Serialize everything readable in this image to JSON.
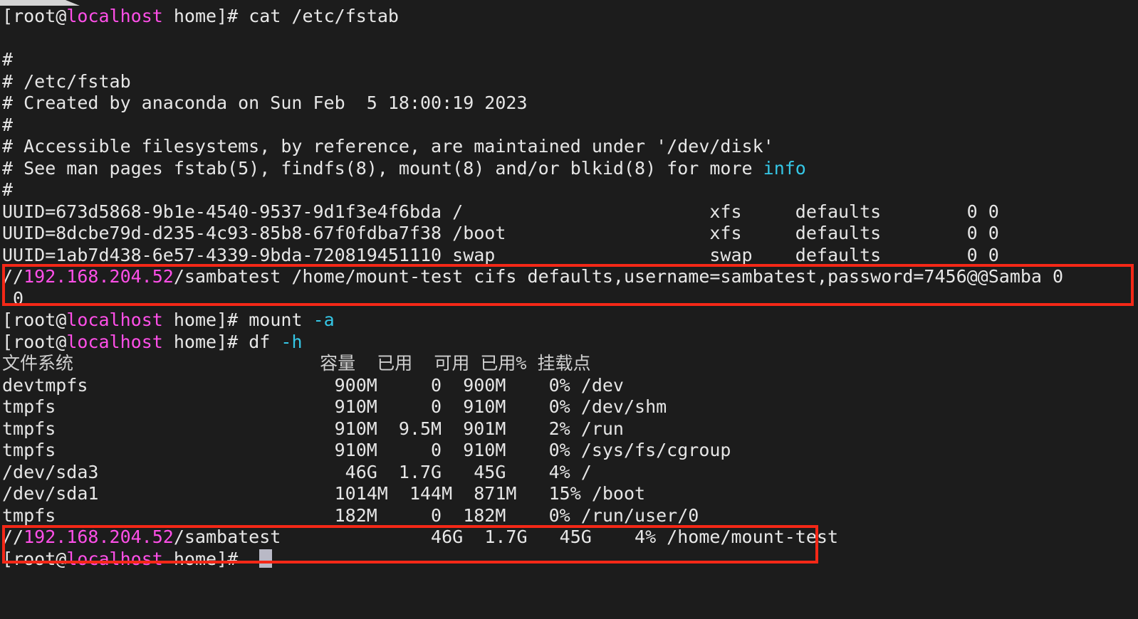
{
  "terminal": {
    "background_color": "#1c1c1c",
    "foreground_color": "#e8e8e8",
    "prompt_host_color": "#ff4fe8",
    "flag_color": "#35c7e6",
    "annotation_color": "#f42817",
    "prompt": {
      "bracket_open": "[",
      "user": "root",
      "at": "@",
      "host": "localhost",
      "space": " ",
      "cwd": "home",
      "bracket_close": "]# "
    },
    "lines": [
      {
        "id": "cmd-cat-fstab",
        "prompt": true,
        "command": "cat /etc/fstab",
        "flag": ""
      },
      {
        "id": "blank-1",
        "text": ""
      },
      {
        "id": "fstab-hash-1",
        "text": "#"
      },
      {
        "id": "fstab-path",
        "text": "# /etc/fstab"
      },
      {
        "id": "fstab-created",
        "text": "# Created by anaconda on Sun Feb  5 18:00:19 2023"
      },
      {
        "id": "fstab-hash-2",
        "text": "#"
      },
      {
        "id": "fstab-accessible",
        "text": "# Accessible filesystems, by reference, are maintained under '/dev/disk'"
      },
      {
        "id": "fstab-seeman-pre",
        "text": "# See man pages fstab(5), findfs(8), mount(8) and/or blkid(8) for more "
      },
      {
        "id": "fstab-seeman-info",
        "text": "info"
      },
      {
        "id": "fstab-hash-3",
        "text": "#"
      },
      {
        "id": "fstab-root",
        "text": "UUID=673d5868-9b1e-4540-9537-9d1f3e4f6bda /                       xfs     defaults        0 0"
      },
      {
        "id": "fstab-boot",
        "text": "UUID=8dcbe79d-d235-4c93-85b8-67f0fdba7f38 /boot                   xfs     defaults        0 0"
      },
      {
        "id": "fstab-swap",
        "text": "UUID=1ab7d438-6e57-4339-9bda-720819451110 swap                    swap    defaults        0 0"
      },
      {
        "id": "fstab-cifs-prefix",
        "text": "//"
      },
      {
        "id": "fstab-cifs-ip",
        "text": "192.168.204.52"
      },
      {
        "id": "fstab-cifs-rest",
        "text": "/sambatest /home/mount-test cifs defaults,username=sambatest,password=7456@@Samba 0"
      },
      {
        "id": "fstab-cifs-wrap",
        "text": " 0"
      },
      {
        "id": "cmd-mount-a",
        "prompt": true,
        "command": "mount ",
        "flag": "-a"
      },
      {
        "id": "cmd-df-h",
        "prompt": true,
        "command": "df ",
        "flag": "-h"
      }
    ],
    "df_output": {
      "headers": {
        "filesystem": "文件系统",
        "size": "容量",
        "used": "已用",
        "avail": "可用",
        "use_pct": "已用%",
        "mounted_on": "挂载点"
      },
      "header_line": "文件系统                       容量  已用  可用 已用% 挂载点",
      "rows": [
        {
          "filesystem": "devtmpfs",
          "size": "900M",
          "used": "0",
          "avail": "900M",
          "use_pct": "0%",
          "mounted_on": "/dev",
          "line": "devtmpfs                       900M     0  900M    0% /dev"
        },
        {
          "filesystem": "tmpfs",
          "size": "910M",
          "used": "0",
          "avail": "910M",
          "use_pct": "0%",
          "mounted_on": "/dev/shm",
          "line": "tmpfs                          910M     0  910M    0% /dev/shm"
        },
        {
          "filesystem": "tmpfs",
          "size": "910M",
          "used": "9.5M",
          "avail": "901M",
          "use_pct": "2%",
          "mounted_on": "/run",
          "line": "tmpfs                          910M  9.5M  901M    2% /run"
        },
        {
          "filesystem": "tmpfs",
          "size": "910M",
          "used": "0",
          "avail": "910M",
          "use_pct": "0%",
          "mounted_on": "/sys/fs/cgroup",
          "line": "tmpfs                          910M     0  910M    0% /sys/fs/cgroup"
        },
        {
          "filesystem": "/dev/sda3",
          "size": "46G",
          "used": "1.7G",
          "avail": "45G",
          "use_pct": "4%",
          "mounted_on": "/",
          "line": "/dev/sda3                       46G  1.7G   45G    4% /"
        },
        {
          "filesystem": "/dev/sda1",
          "size": "1014M",
          "used": "144M",
          "avail": "871M",
          "use_pct": "15%",
          "mounted_on": "/boot",
          "line": "/dev/sda1                      1014M  144M  871M   15% /boot"
        },
        {
          "filesystem": "tmpfs",
          "size": "182M",
          "used": "0",
          "avail": "182M",
          "use_pct": "0%",
          "mounted_on": "/run/user/0",
          "line": "tmpfs                          182M     0  182M    0% /run/user/0"
        }
      ],
      "cifs_row": {
        "prefix": "//",
        "ip": "192.168.204.52",
        "share": "/sambatest",
        "size": "46G",
        "used": "1.7G",
        "avail": "45G",
        "use_pct": "4%",
        "mounted_on": "/home/mount-test",
        "tail": "/sambatest              46G  1.7G   45G    4% /home/mount-test"
      }
    },
    "final_prompt": {
      "bracket_open": "[",
      "user": "root",
      "at": "@",
      "host": "localhost",
      "cwd": "home",
      "bracket_close": "]# "
    }
  }
}
